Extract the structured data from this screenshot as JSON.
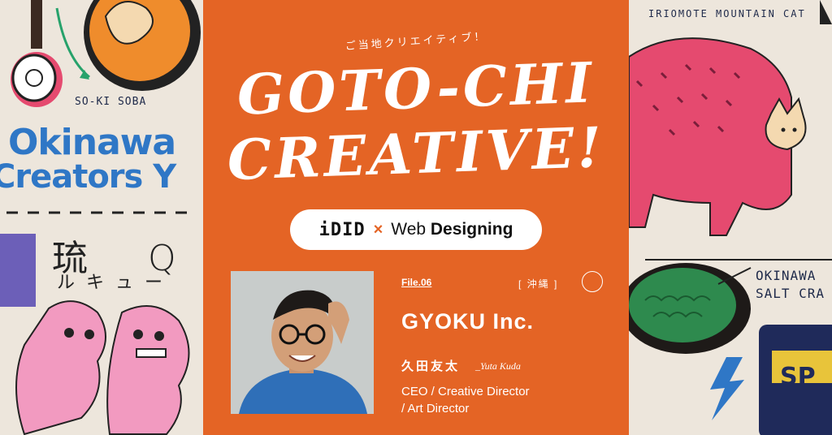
{
  "left_art": {
    "soba_label": "SO-KI SOBA",
    "okinawa_line1": "Okinawa",
    "okinawa_line2": "Creators Y",
    "ryu_kanji": "琉 Q",
    "ryu_kana": "ルキュー"
  },
  "right_art": {
    "cat_label": "IRIOMOTE MOUNTAIN CAT",
    "salt_line1": "OKINAWA",
    "salt_line2": "SALT CRA",
    "can_label": "SP"
  },
  "header": {
    "kicker": "ご当地クリエイティブ！",
    "title_line1": "GOTO-CHI",
    "title_line2": "CREATIVE!"
  },
  "collab": {
    "brand1": "iDID",
    "cross": "×",
    "brand2_light": "Web ",
    "brand2_bold": "Designing"
  },
  "profile": {
    "file": "File.06",
    "region": "[ 沖縄 ]",
    "company": "GYOKU Inc.",
    "name_ja": "久田友太",
    "name_en": "_Yuta Kuda",
    "role_line1": "CEO / Creative Director",
    "role_line2": "/ Art Director"
  },
  "colors": {
    "accent_orange": "#e46425",
    "okinawa_blue": "#2f77c6",
    "cat_pink": "#e54a6f",
    "background_cream": "#efe9df"
  }
}
